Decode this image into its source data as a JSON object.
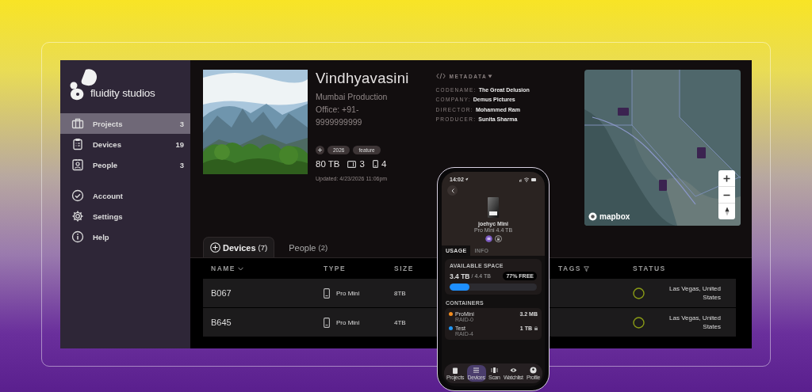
{
  "brand": {
    "name": "fluidity studios"
  },
  "sidebar": {
    "items": [
      {
        "label": "Projects",
        "count": "3",
        "selected": true
      },
      {
        "label": "Devices",
        "count": "19",
        "selected": false
      },
      {
        "label": "People",
        "count": "3",
        "selected": false
      }
    ],
    "secondary": [
      {
        "label": "Account",
        "selected": false
      },
      {
        "label": "Settings",
        "selected": false
      },
      {
        "label": "Help",
        "selected": false
      }
    ]
  },
  "project": {
    "title": "Vindhyavasini",
    "subtitle": "Mumbai Production",
    "office": "Office: +91-9999999999",
    "tags": [
      "2026",
      "feature"
    ],
    "storage": "80 TB",
    "drives": "3",
    "phones": "4",
    "updated": "Updated: 4/23/2026 11:06pm"
  },
  "metadata": {
    "title": "METADATA",
    "fields": [
      {
        "key": "CODENAME:",
        "value": "The Great Delusion"
      },
      {
        "key": "COMPANY:",
        "value": "Demus Pictures"
      },
      {
        "key": "DIRECTOR:",
        "value": "Mohammed Ram"
      },
      {
        "key": "PRODUCER:",
        "value": "Sunita Sharma"
      }
    ]
  },
  "map": {
    "attribution": "mapbox"
  },
  "tabs": [
    {
      "label": "Devices",
      "count": "(7)",
      "selected": true
    },
    {
      "label": "People",
      "count": "(2)",
      "selected": false
    }
  ],
  "table": {
    "columns": [
      "NAME",
      "TYPE",
      "SIZE",
      "TAGS",
      "STATUS"
    ],
    "rows": [
      {
        "name": "B067",
        "type": "Pro Mini",
        "size": "8TB",
        "location": "Las Vegas, United States"
      },
      {
        "name": "B645",
        "type": "Pro Mini",
        "size": "4TB",
        "location": "Las Vegas, United States"
      }
    ]
  },
  "phone": {
    "time": "14:02",
    "device": {
      "name": "joehyc Mini",
      "model": "Pro Mini 4.4 TB"
    },
    "tabs": [
      {
        "label": "USAGE",
        "selected": true
      },
      {
        "label": "INFO",
        "selected": false
      }
    ],
    "space": {
      "title": "AVAILABLE SPACE",
      "used": "3.4 TB",
      "total": "/ 4.4 TB",
      "free": "77% FREE",
      "level": 0.23
    },
    "containers": {
      "title": "CONTAINERS",
      "items": [
        {
          "name": "ProMini",
          "size": "3.2 MB",
          "raid": "RAID-0",
          "color": "#f28c1e",
          "locked": false
        },
        {
          "name": "Test",
          "size": "1 TB",
          "raid": "RAID-4",
          "color": "#2196f3",
          "locked": true
        }
      ]
    },
    "nav": [
      {
        "label": "Projects",
        "selected": false
      },
      {
        "label": "Devices",
        "selected": true
      },
      {
        "label": "Scan",
        "selected": false
      },
      {
        "label": "Watchlist",
        "selected": false
      },
      {
        "label": "Profile",
        "selected": false
      }
    ]
  }
}
